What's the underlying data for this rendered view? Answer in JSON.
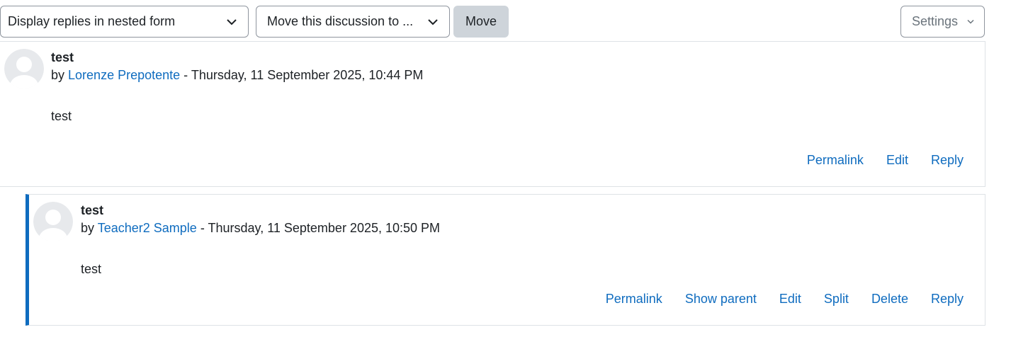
{
  "toolbar": {
    "display_mode": "Display replies in nested form",
    "move_target": "Move this discussion to ...",
    "move_label": "Move",
    "settings_label": "Settings"
  },
  "posts": [
    {
      "subject": "test",
      "by": "by",
      "author": "Lorenze Prepotente",
      "separator": "-",
      "date": "Thursday, 11 September 2025, 10:44 PM",
      "body": "test",
      "actions": [
        "Permalink",
        "Edit",
        "Reply"
      ]
    },
    {
      "subject": "test",
      "by": "by",
      "author": "Teacher2 Sample",
      "separator": "-",
      "date": "Thursday, 11 September 2025, 10:50 PM",
      "body": "test",
      "actions": [
        "Permalink",
        "Show parent",
        "Edit",
        "Split",
        "Delete",
        "Reply"
      ]
    }
  ],
  "colors": {
    "link": "#0f6cbf",
    "reply_border": "#0f6cbf",
    "move_button_bg": "#ced4da",
    "avatar_bg": "#e7e9ec"
  },
  "icons": {
    "select_caret": "chevron-down-icon",
    "settings_caret": "chevron-down-icon",
    "avatar": "user-avatar-icon"
  }
}
